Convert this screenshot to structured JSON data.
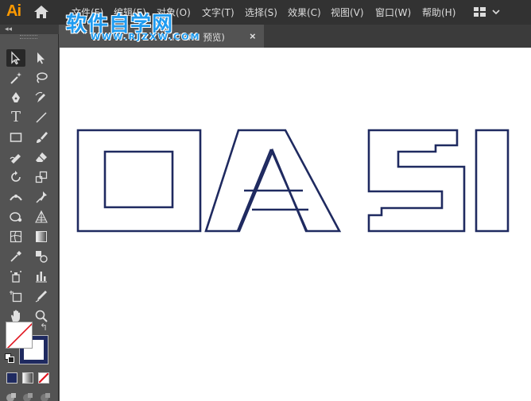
{
  "app": {
    "logo": "Ai"
  },
  "menu": [
    {
      "label": "文件(F)",
      "name": "menu-file"
    },
    {
      "label": "编辑(E)",
      "name": "menu-edit"
    },
    {
      "label": "对象(O)",
      "name": "menu-object"
    },
    {
      "label": "文字(T)",
      "name": "menu-type"
    },
    {
      "label": "选择(S)",
      "name": "menu-select"
    },
    {
      "label": "效果(C)",
      "name": "menu-effect"
    },
    {
      "label": "视图(V)",
      "name": "menu-view"
    },
    {
      "label": "窗口(W)",
      "name": "menu-window"
    },
    {
      "label": "帮助(H)",
      "name": "menu-help"
    }
  ],
  "watermark": {
    "title": "软件自学网",
    "url": "WWW.RJZXW.COM"
  },
  "document_tab": {
    "label": "K/GPU 预览)",
    "close": "×"
  },
  "toolbar": {
    "collapse": "◂◂",
    "type_tool": "T",
    "swap": "↰"
  },
  "colors": {
    "fill": "none",
    "stroke": "#1f2a60",
    "canvas": "#ffffff",
    "accent": "#ff9a00"
  },
  "artwork": {
    "text": "OASI",
    "style": "outlined"
  }
}
